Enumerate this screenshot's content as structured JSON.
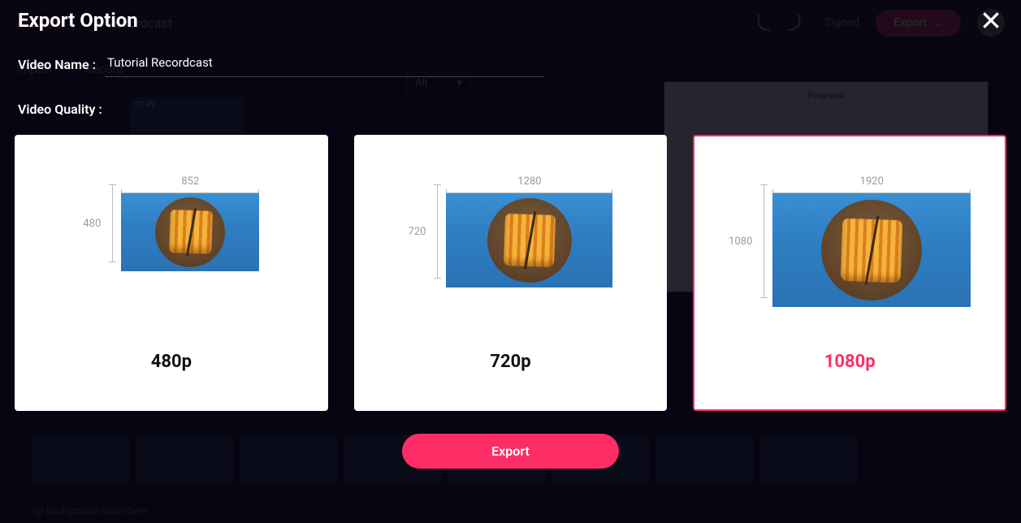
{
  "bg": {
    "logo": "dCast",
    "doc_title": "al Recordcast",
    "import": "Import",
    "record": "Record",
    "filter_all": "All",
    "signed": "Signed",
    "export_btn": "Export",
    "preview_title": "Programa",
    "clip_time": "01:49",
    "music_hint": "op background music here"
  },
  "modal": {
    "title": "Export Option",
    "video_name_label": "Video Name :",
    "video_name_value": "Tutorial Recordcast",
    "video_quality_label": "Video Quality :",
    "export_button": "Export",
    "options": [
      {
        "id": "480",
        "width": "852",
        "height": "480",
        "label": "480p",
        "selected": false
      },
      {
        "id": "720",
        "width": "1280",
        "height": "720",
        "label": "720p",
        "selected": false
      },
      {
        "id": "1080",
        "width": "1920",
        "height": "1080",
        "label": "1080p",
        "selected": true
      }
    ]
  }
}
